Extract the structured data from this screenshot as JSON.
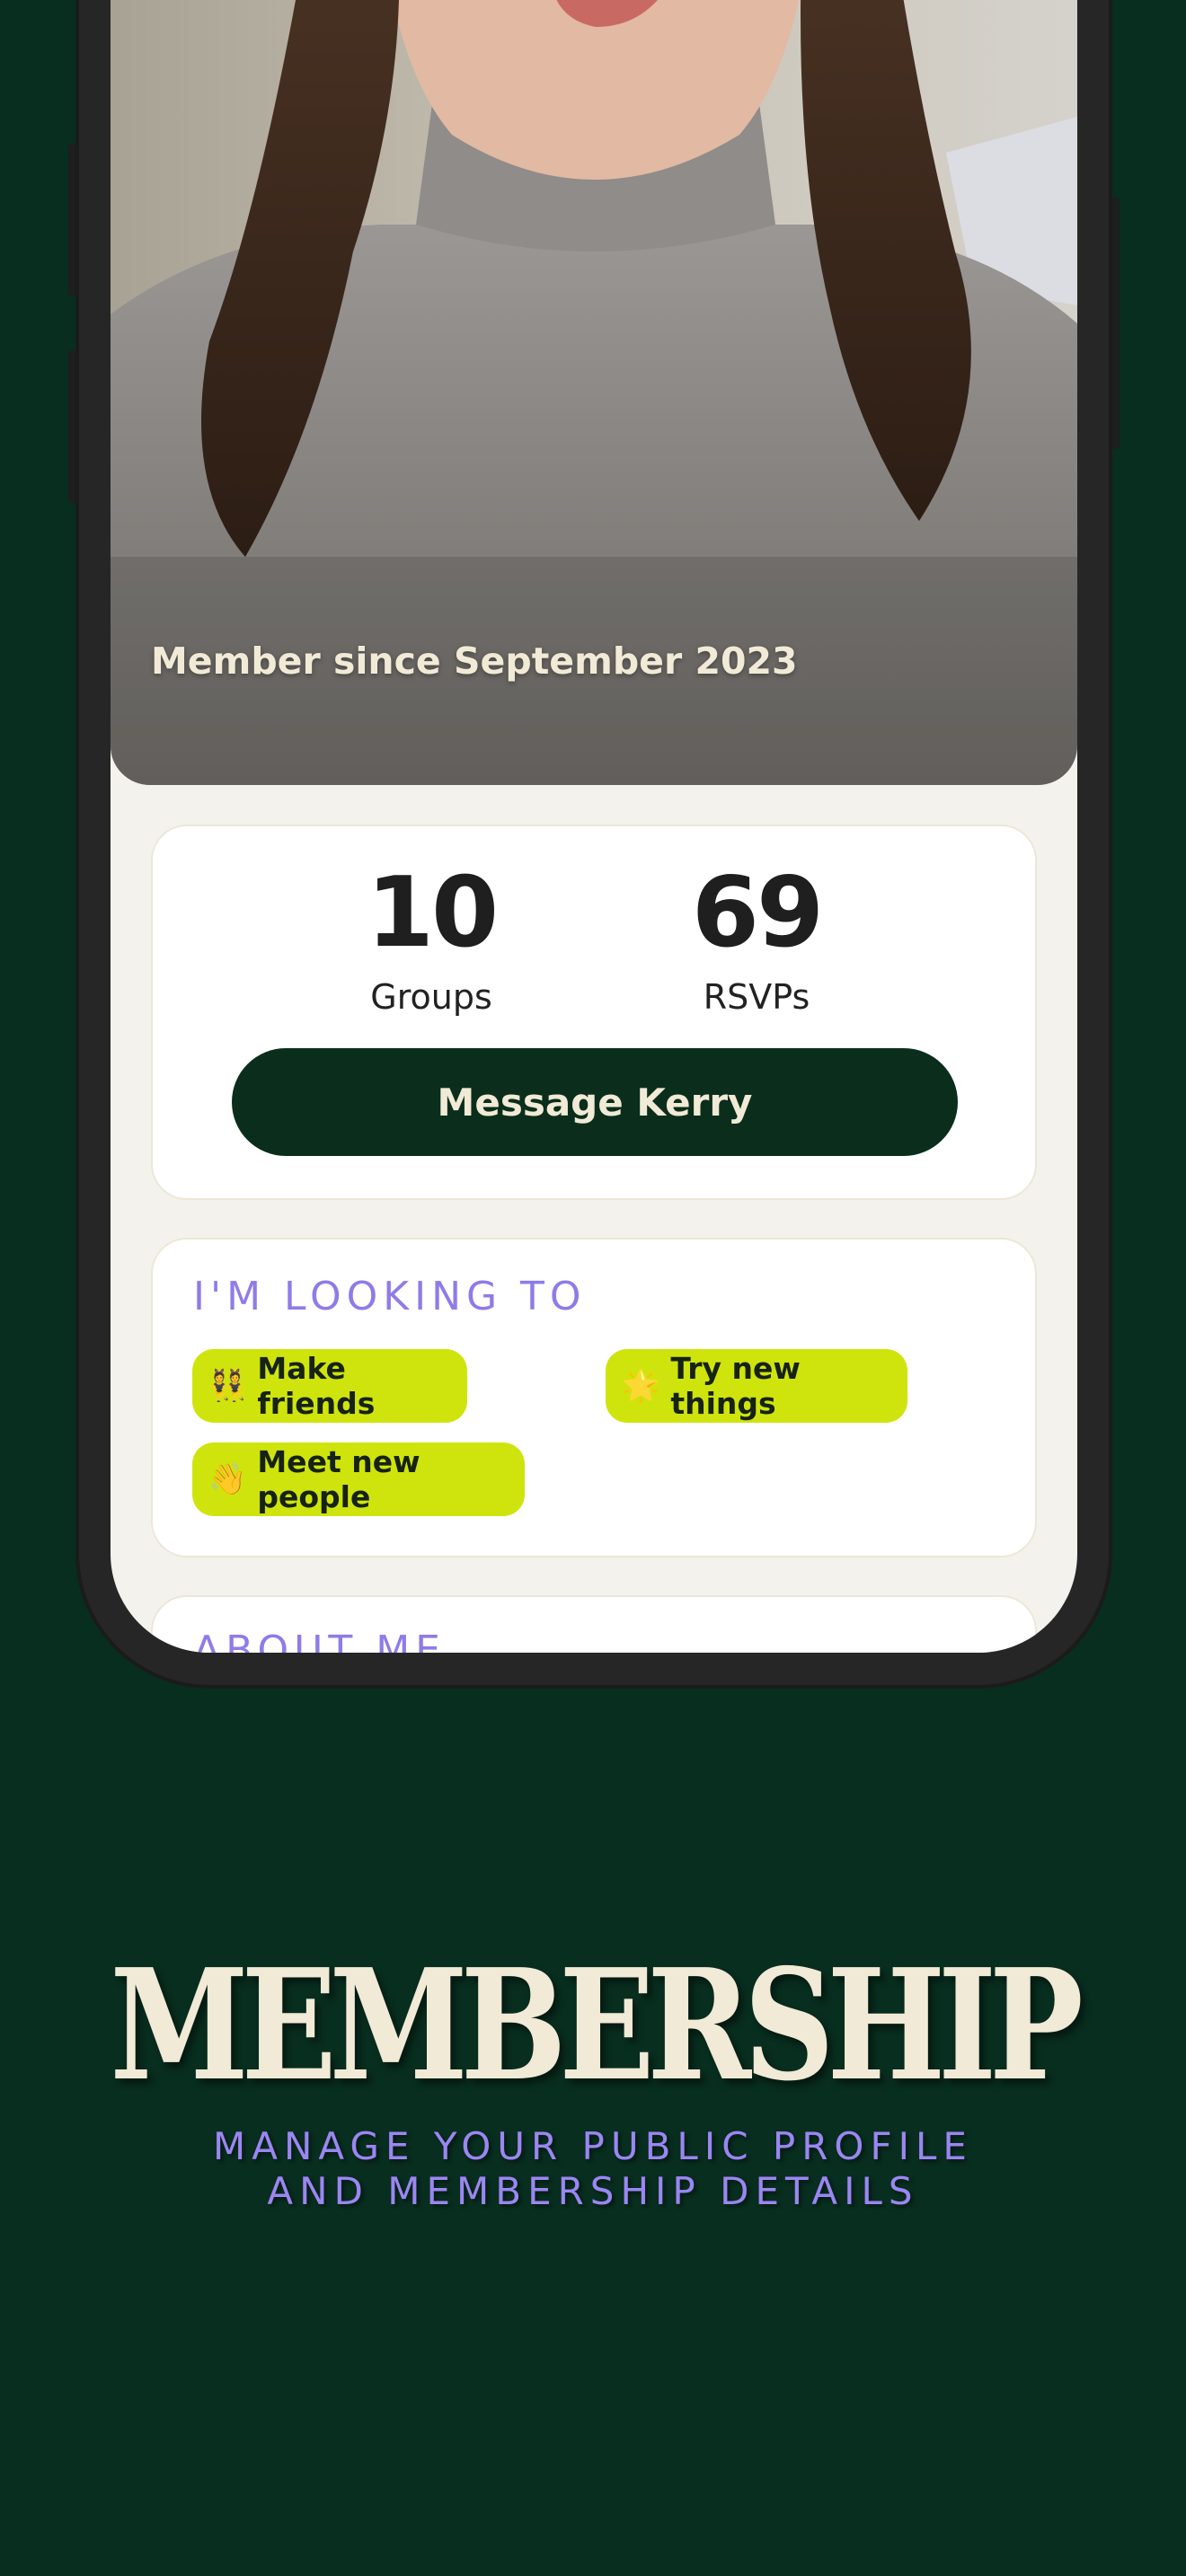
{
  "profile": {
    "member_since": "Member since September 2023",
    "stats": {
      "groups_value": "10",
      "groups_label": "Groups",
      "rsvps_value": "69",
      "rsvps_label": "RSVPs"
    },
    "message_button_label": "Message Kerry"
  },
  "looking_to": {
    "title": "I'M LOOKING TO",
    "chips": [
      {
        "emoji": "👯",
        "label": "Make friends"
      },
      {
        "emoji": "🌟",
        "label": "Try new things"
      },
      {
        "emoji": "👋",
        "label": "Meet new people"
      }
    ]
  },
  "about": {
    "title": "ABOUT ME"
  },
  "marketing": {
    "headline": "MEMBERSHIP",
    "subhead_line1": "MANAGE YOUR PUBLIC PROFILE",
    "subhead_line2": "AND MEMBERSHIP DETAILS"
  },
  "colors": {
    "background": "#082e1f",
    "button": "#0a2e1b",
    "chip": "#cfe40c",
    "accent_purple": "#8d7ce8",
    "cream": "#f1ead6"
  }
}
